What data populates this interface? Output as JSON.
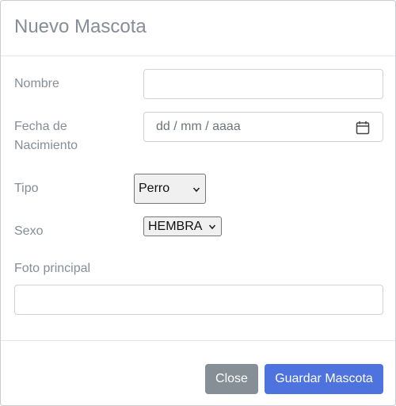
{
  "modal": {
    "title": "Nuevo Mascota"
  },
  "form": {
    "nombre": {
      "label": "Nombre",
      "value": ""
    },
    "fecha": {
      "label_line1": "Fecha de",
      "label_line2": "Nacimiento",
      "placeholder": "dd / mm / aaaa",
      "icon": "calendar-icon"
    },
    "tipo": {
      "label": "Tipo",
      "selected": "Perro"
    },
    "sexo": {
      "label": "Sexo",
      "selected": "HEMBRA"
    },
    "foto": {
      "label": "Foto principal",
      "value": ""
    }
  },
  "footer": {
    "close_label": "Close",
    "save_label": "Guardar Mascota"
  },
  "colors": {
    "primary": "#4e73df",
    "secondary": "#868e96",
    "label": "#858d97"
  }
}
